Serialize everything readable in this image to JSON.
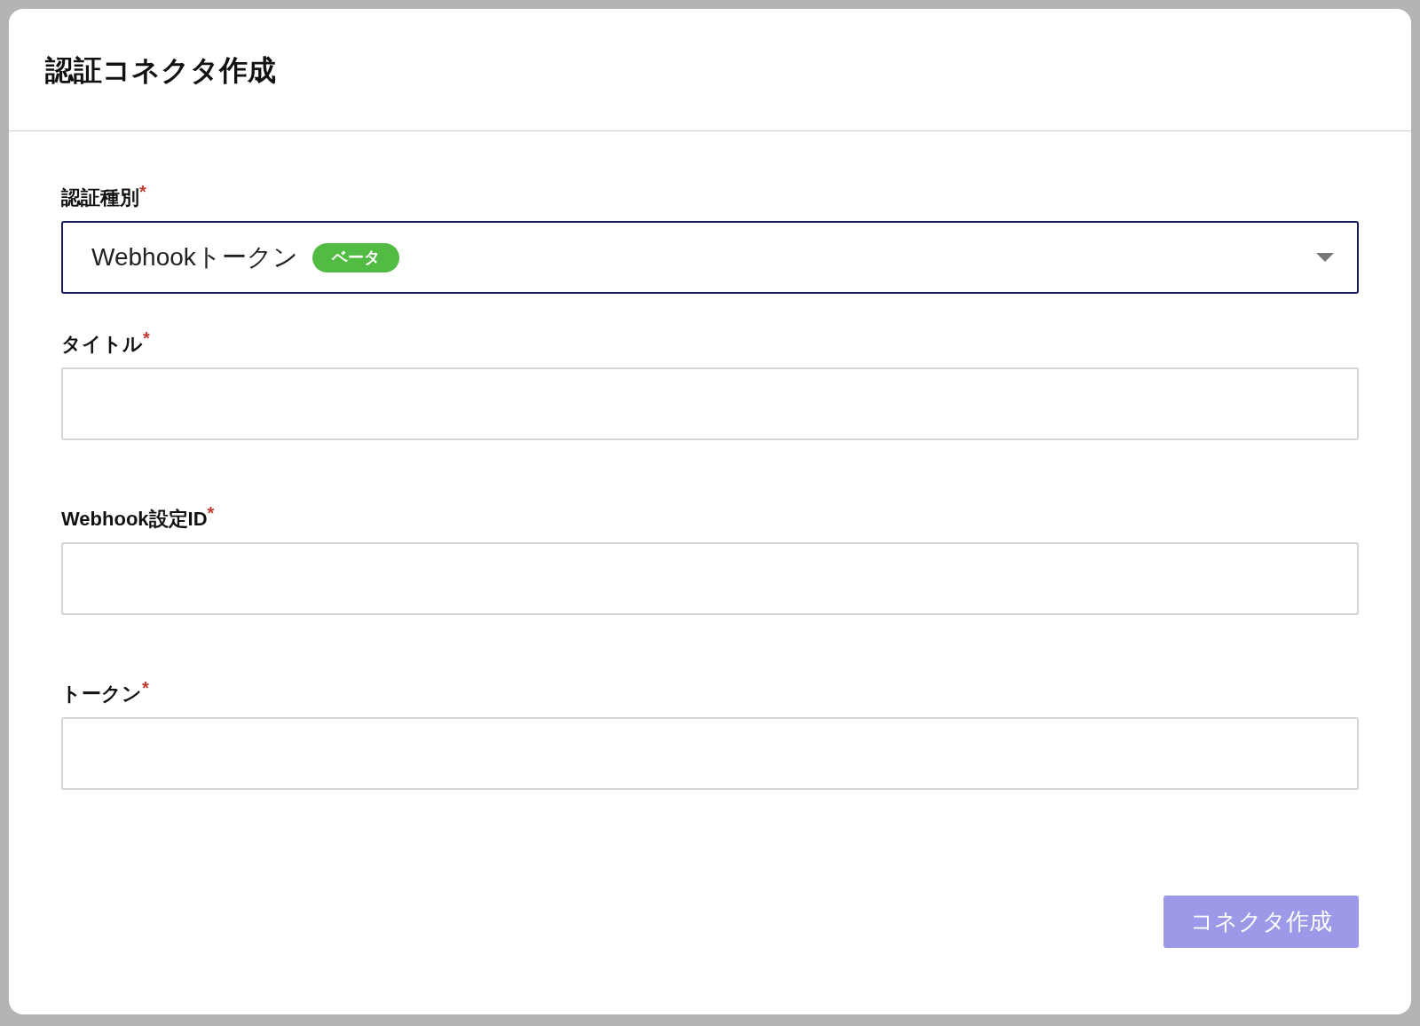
{
  "dialog": {
    "title": "認証コネクタ作成"
  },
  "fields": [
    {
      "kind": "select",
      "label": "認証種別",
      "required_mark": "*",
      "value": "Webhookトークン",
      "badge": "ベータ"
    },
    {
      "kind": "text",
      "label": "タイトル",
      "required_mark": "*"
    },
    {
      "kind": "text",
      "label": "Webhook設定ID",
      "required_mark": "*"
    },
    {
      "kind": "text",
      "label": "トークン",
      "required_mark": "*"
    }
  ],
  "submit_button": {
    "label": "コネクタ作成",
    "disabled": true
  }
}
